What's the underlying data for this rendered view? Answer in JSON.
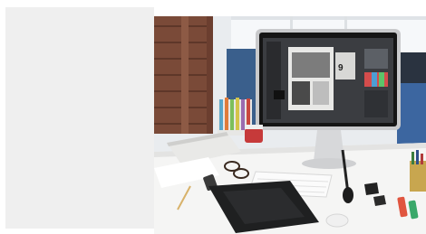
{
  "page": {
    "background": "#ffffff",
    "placeholder_color": "#efefef"
  },
  "photo": {
    "scene": "designer-workspace-desk",
    "objects": [
      "brick-wall",
      "window",
      "blue-office-partition",
      "desktop-monitor",
      "wireless-keyboard",
      "graphics-tablet",
      "stylus",
      "color-markers",
      "notebook",
      "eyeglasses",
      "mug",
      "binder-clips",
      "computer-mouse"
    ]
  }
}
